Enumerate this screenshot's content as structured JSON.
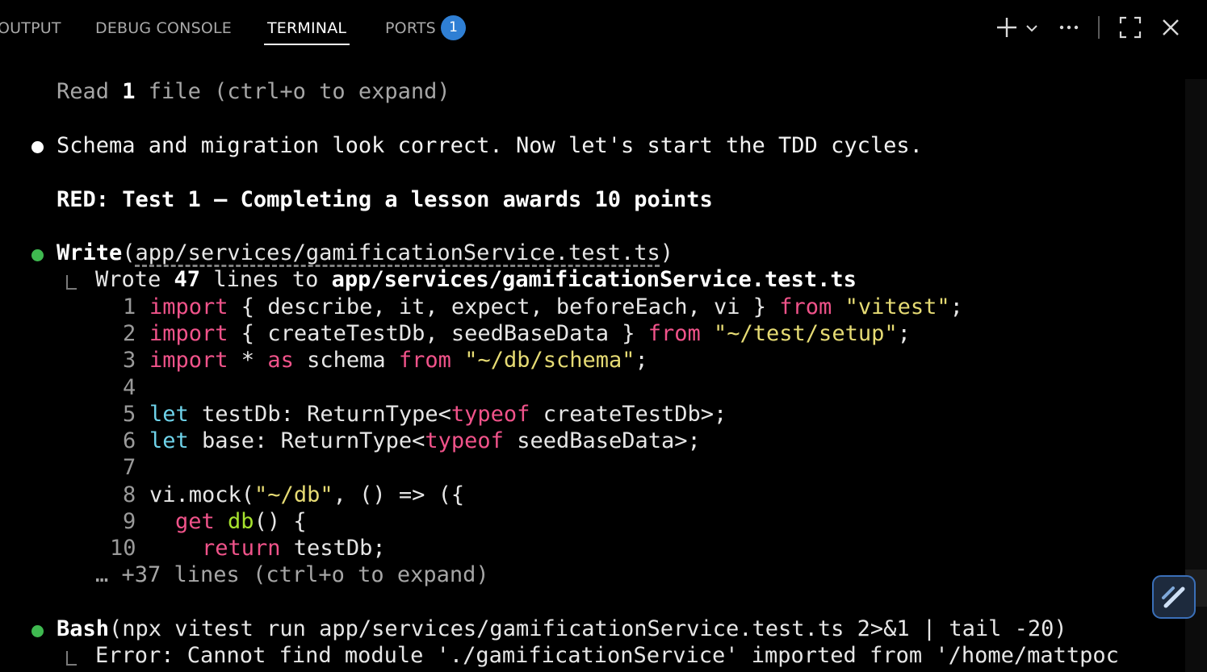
{
  "tabs": [
    {
      "label": "OUTPUT"
    },
    {
      "label": "DEBUG CONSOLE"
    },
    {
      "label": "TERMINAL"
    },
    {
      "label": "PORTS"
    }
  ],
  "ports_badge": "1",
  "header_icons": {
    "new_terminal": "plus-icon",
    "dropdown": "chevron-down-icon",
    "more": "ellipsis-icon",
    "maximize": "maximize-icon",
    "close": "close-icon"
  },
  "colors": {
    "accent": "#2f7fd4",
    "bullet_success": "#3fb950",
    "keyword": "#f0538a",
    "type_keyword": "#6fd3ea",
    "string": "#e6db74"
  },
  "terminal": {
    "read_line": {
      "prefix": "Read ",
      "count": "1",
      "suffix": " file (ctrl+o to expand)"
    },
    "schema_message": "Schema and migration look correct. Now let's start the TDD cycles.",
    "red_heading": "RED: Test 1 — Completing a lesson awards 10 points",
    "write_tool": {
      "name": "Write",
      "open": "(",
      "arg": "app/services/gamificationService.test.ts",
      "close": ")"
    },
    "wrote_line": {
      "prefix": "Wrote ",
      "count": "47",
      "middle": " lines to ",
      "path": "app/services/gamificationService.test.ts"
    },
    "code": {
      "l1": {
        "n": "1",
        "t1": "import",
        "t2": " { describe, it, expect, beforeEach, vi } ",
        "t3": "from",
        "t4": " ",
        "t5": "\"vitest\"",
        "t6": ";"
      },
      "l2": {
        "n": "2",
        "t1": "import",
        "t2": " { createTestDb, seedBaseData } ",
        "t3": "from",
        "t4": " ",
        "t5": "\"~/test/setup\"",
        "t6": ";"
      },
      "l3": {
        "n": "3",
        "t1": "import",
        "t2": " * ",
        "t3": "as",
        "t4": " schema ",
        "t5": "from",
        "t6": " ",
        "t7": "\"~/db/schema\"",
        "t8": ";"
      },
      "l4": {
        "n": "4"
      },
      "l5": {
        "n": "5",
        "t1": "let",
        "t2": " testDb: ReturnType<",
        "t3": "typeof",
        "t4": " createTestDb>;"
      },
      "l6": {
        "n": "6",
        "t1": "let",
        "t2": " base: ReturnType<",
        "t3": "typeof",
        "t4": " seedBaseData>;"
      },
      "l7": {
        "n": "7"
      },
      "l8": {
        "n": "8",
        "t1": "vi.mock(",
        "t2": "\"~/db\"",
        "t3": ", () => ({"
      },
      "l9": {
        "n": "9",
        "t1": "get",
        "t2": " ",
        "t3": "db",
        "t4": "() {"
      },
      "l10": {
        "n": "10",
        "t1": "return",
        "t2": " testDb;"
      }
    },
    "more_lines": "… +37 lines (ctrl+o to expand)",
    "bash_tool": {
      "name": "Bash",
      "args": "(npx vitest run app/services/gamificationService.test.ts 2>&1 | tail -20)"
    },
    "error_line": "Error: Cannot find module './gamificationService' imported from '/home/mattpoc"
  }
}
